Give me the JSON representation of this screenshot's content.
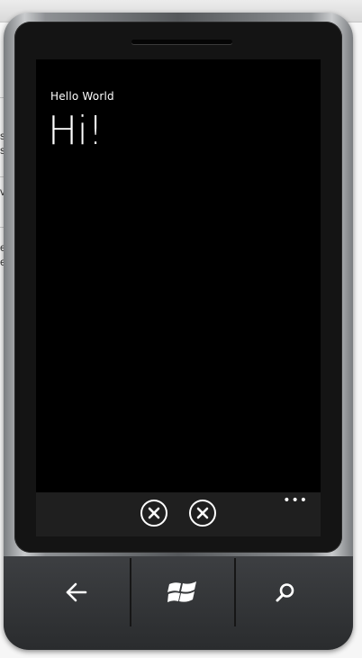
{
  "app": {
    "application_title": "Hello World",
    "page_title": "Hi!"
  },
  "background_fragments": [
    "s",
    "s",
    "v",
    "e",
    "e"
  ],
  "appbar": {
    "buttons": [
      {
        "icon": "cancel-icon"
      },
      {
        "icon": "cancel-icon"
      }
    ],
    "ellipsis": "•••"
  },
  "hardware_buttons": [
    {
      "icon": "back-arrow-icon"
    },
    {
      "icon": "windows-logo-icon"
    },
    {
      "icon": "search-icon"
    }
  ],
  "colors": {
    "screen_background": "#000000",
    "appbar_background": "#1f1f1f",
    "foreground": "#ffffff"
  }
}
